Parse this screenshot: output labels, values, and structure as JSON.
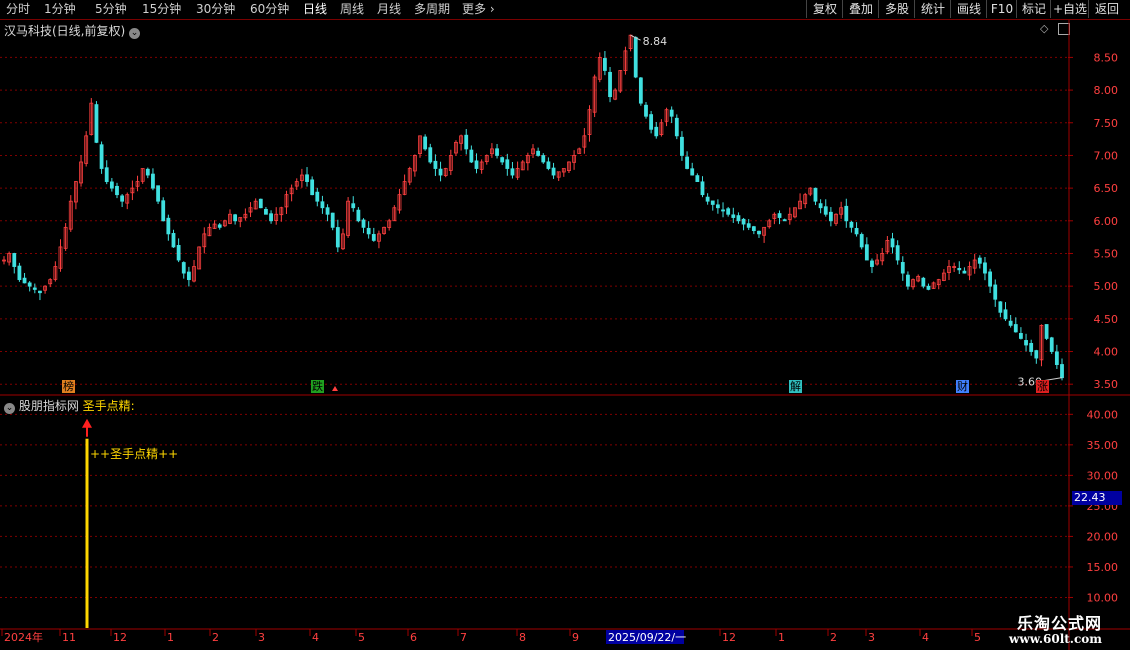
{
  "toolbar": {
    "periods": [
      "分时",
      "1分钟",
      "5分钟",
      "15分钟",
      "30分钟",
      "60分钟",
      "日线",
      "周线",
      "月线",
      "多周期",
      "更多"
    ],
    "active_period": "日线",
    "right_buttons": [
      "复权",
      "叠加",
      "多股",
      "统计",
      "画线",
      "F10",
      "标记",
      "+自选",
      "返回"
    ]
  },
  "main_pane": {
    "title": "汉马科技(日线,前复权)",
    "high_label": "8.84",
    "low_label": "3.60",
    "events": [
      {
        "text": "榜",
        "bg": "#e08020"
      },
      {
        "text": "跌",
        "bg": "#20a020"
      },
      {
        "text": "解",
        "bg": "#30c0c0"
      },
      {
        "text": "财",
        "bg": "#4080ff"
      },
      {
        "text": "涨",
        "bg": "#e02020"
      }
    ]
  },
  "indicator_pane": {
    "source": "股朋指标网",
    "name": "圣手点精:",
    "signal_label": "++圣手点精++",
    "current_value": "22.43"
  },
  "chart_data": {
    "type": "candlestick",
    "price_axis": [
      3.5,
      4.0,
      4.5,
      5.0,
      5.5,
      6.0,
      6.5,
      7.0,
      7.5,
      8.0,
      8.5
    ],
    "price_ylim": [
      3.35,
      8.95
    ],
    "indicator_axis": [
      10.0,
      15.0,
      20.0,
      25.0,
      30.0,
      35.0,
      40.0
    ],
    "indicator_ylim": [
      5,
      43
    ],
    "signal_bar_value": 36,
    "time_axis": [
      "2024年",
      "11",
      "12",
      "1",
      "2",
      "3",
      "4",
      "5",
      "6",
      "7",
      "8",
      "9",
      "2025/09/22/一",
      "12",
      "1",
      "2",
      "3",
      "4",
      "5"
    ],
    "price_path": [
      5.4,
      5.5,
      5.3,
      5.1,
      5.05,
      5.0,
      4.95,
      4.9,
      5.0,
      5.1,
      5.3,
      5.6,
      5.9,
      6.3,
      6.6,
      6.9,
      7.3,
      7.8,
      7.2,
      6.8,
      6.6,
      6.5,
      6.4,
      6.3,
      6.4,
      6.5,
      6.6,
      6.8,
      6.7,
      6.5,
      6.3,
      6.0,
      5.8,
      5.6,
      5.4,
      5.2,
      5.1,
      5.3,
      5.6,
      5.8,
      5.9,
      5.95,
      5.9,
      6.0,
      6.1,
      6.0,
      6.05,
      6.1,
      6.2,
      6.3,
      6.2,
      6.1,
      6.0,
      6.1,
      6.2,
      6.4,
      6.5,
      6.6,
      6.7,
      6.6,
      6.4,
      6.3,
      6.2,
      6.1,
      5.9,
      5.6,
      5.8,
      6.3,
      6.2,
      6.0,
      5.9,
      5.8,
      5.7,
      5.8,
      5.9,
      6.0,
      6.2,
      6.4,
      6.6,
      6.8,
      7.0,
      7.3,
      7.1,
      6.9,
      6.8,
      6.7,
      6.8,
      7.0,
      7.2,
      7.3,
      7.1,
      6.9,
      6.8,
      6.9,
      7.0,
      7.1,
      7.0,
      6.9,
      6.8,
      6.7,
      6.8,
      6.9,
      7.0,
      7.1,
      7.0,
      6.9,
      6.8,
      6.7,
      6.75,
      6.8,
      6.9,
      7.0,
      7.1,
      7.3,
      7.7,
      8.2,
      8.5,
      8.3,
      7.9,
      8.0,
      8.3,
      8.6,
      8.84,
      8.2,
      7.8,
      7.6,
      7.4,
      7.3,
      7.5,
      7.7,
      7.6,
      7.3,
      7.0,
      6.8,
      6.7,
      6.6,
      6.4,
      6.3,
      6.25,
      6.2,
      6.15,
      6.1,
      6.05,
      6.0,
      5.95,
      5.9,
      5.85,
      5.8,
      5.9,
      6.0,
      6.1,
      6.05,
      6.0,
      6.1,
      6.2,
      6.3,
      6.4,
      6.5,
      6.3,
      6.2,
      6.1,
      6.0,
      6.1,
      6.2,
      6.0,
      5.9,
      5.8,
      5.6,
      5.4,
      5.3,
      5.4,
      5.5,
      5.7,
      5.6,
      5.4,
      5.2,
      5.0,
      5.1,
      5.15,
      5.0,
      4.95,
      5.05,
      5.1,
      5.2,
      5.3,
      5.3,
      5.25,
      5.2,
      5.3,
      5.4,
      5.35,
      5.2,
      5.0,
      4.8,
      4.6,
      4.5,
      4.4,
      4.3,
      4.2,
      4.1,
      4.0,
      3.9,
      4.4,
      4.2,
      4.0,
      3.8,
      3.6
    ]
  }
}
